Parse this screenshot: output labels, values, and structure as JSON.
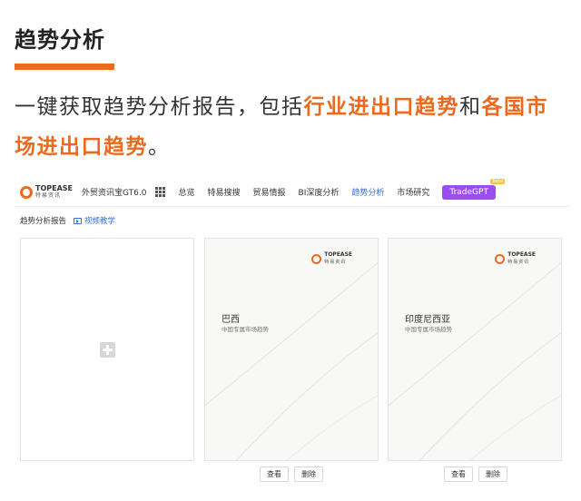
{
  "section": {
    "title": "趋势分析",
    "accent_color": "#ec6a1f"
  },
  "intro": {
    "part1": "一键获取趋势分析报告，包括",
    "highlight1": "行业进出口趋势",
    "part2": "和",
    "highlight2": "各国市场进出口趋势",
    "part3": "。"
  },
  "app": {
    "logo": {
      "en": "TOPEASE",
      "cn": "特易资讯"
    },
    "product": "外贸资讯宝GT6.0",
    "apps_icon": "grid-icon",
    "nav": [
      {
        "label": "总览"
      },
      {
        "label": "特易搜搜"
      },
      {
        "label": "贸易情报"
      },
      {
        "label": "BI深度分析"
      },
      {
        "label": "趋势分析"
      },
      {
        "label": "市场研究"
      }
    ],
    "active_nav": "趋势分析",
    "gpt_button": "TradeGPT",
    "gpt_badge": "Beta",
    "breadcrumb": "趋势分析报告",
    "video_link": "视频教学",
    "add_card_icon": "plus-icon",
    "reports": [
      {
        "title": "巴西",
        "subtitle": "中国专属市场趋势",
        "view": "查看",
        "delete": "删除"
      },
      {
        "title": "印度尼西亚",
        "subtitle": "中国专属市场趋势",
        "view": "查看",
        "delete": "删除"
      }
    ],
    "colors": {
      "active": "#3b6fd6",
      "gpt": "#9b4ef0",
      "brand": "#ec6a1f"
    }
  }
}
